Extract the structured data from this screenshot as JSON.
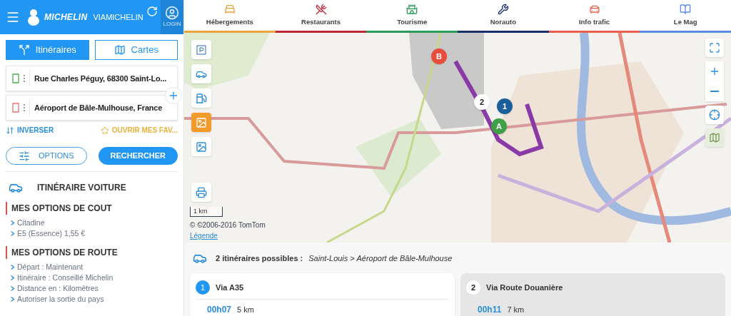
{
  "header": {
    "brand": "MICHELIN",
    "product": "VIAMICHELIN",
    "login": "LOGIN"
  },
  "mode_tabs": [
    {
      "label": "Itinéraires",
      "selected": true
    },
    {
      "label": "Cartes",
      "selected": false
    }
  ],
  "stops": [
    {
      "kind": "start",
      "value": "Rue Charles Péguy, 68300 Saint-Lo..."
    },
    {
      "kind": "end",
      "value": "Aéroport de Bâle-Mulhouse, France"
    }
  ],
  "swap_link": "INVERSER",
  "favorites_link": "OUVRIR MES FAV...",
  "options_button": "OPTIONS",
  "search_button": "RECHERCHER",
  "summary": {
    "title": "ITINÉRAIRE VOITURE",
    "groups": [
      {
        "title": "MES OPTIONS DE COUT",
        "items": [
          "Citadine",
          "E5 (Essence) 1,55 €"
        ]
      },
      {
        "title": "MES OPTIONS DE ROUTE",
        "items": [
          "Départ : Maintenant",
          "Itinéraire : Conseillé Michelin",
          "Distance en : Kilomètres",
          "Autoriser la sortie du pays"
        ]
      }
    ]
  },
  "nav": [
    {
      "kind": "bed",
      "label": "Hébergements",
      "color": "#e8a33c"
    },
    {
      "kind": "food",
      "label": "Restaurants",
      "color": "#c0283a"
    },
    {
      "kind": "castle",
      "label": "Tourisme",
      "color": "#2e9a5a"
    },
    {
      "kind": "garage",
      "label": "Norauto",
      "color": "#1b2f6b"
    },
    {
      "kind": "traffic",
      "label": "Info trafic",
      "color": "#e8604c"
    },
    {
      "kind": "book",
      "label": "Le Mag",
      "color": "#5b8ee0"
    }
  ],
  "map": {
    "scale": "1 km",
    "copyright": "© ©2006-2016 TomTom",
    "legend_link": "Légende",
    "left_tools": [
      {
        "kind": "parking",
        "selected": false
      },
      {
        "kind": "traffic",
        "selected": false
      },
      {
        "kind": "fuel",
        "selected": false
      },
      {
        "kind": "layer",
        "selected": true
      },
      {
        "kind": "layer",
        "selected": false
      }
    ],
    "markers": [
      {
        "label": "B",
        "color": "#e84c3d"
      },
      {
        "label": "2",
        "color": "#ffffff"
      },
      {
        "label": "1",
        "color": "#1a5e9a"
      },
      {
        "label": "A",
        "color": "#3fa047"
      }
    ]
  },
  "results": {
    "count": "2 itinéraires possibles :",
    "route": "Saint-Louis > Aéroport de Bâle-Mulhouse",
    "routes": [
      {
        "number": "1",
        "name": "Via A35",
        "time": "00h07",
        "distance": "5 km",
        "selected": true
      },
      {
        "number": "2",
        "name": "Via Route Douanière",
        "time": "00h11",
        "distance": "7 km",
        "selected": false
      }
    ]
  }
}
